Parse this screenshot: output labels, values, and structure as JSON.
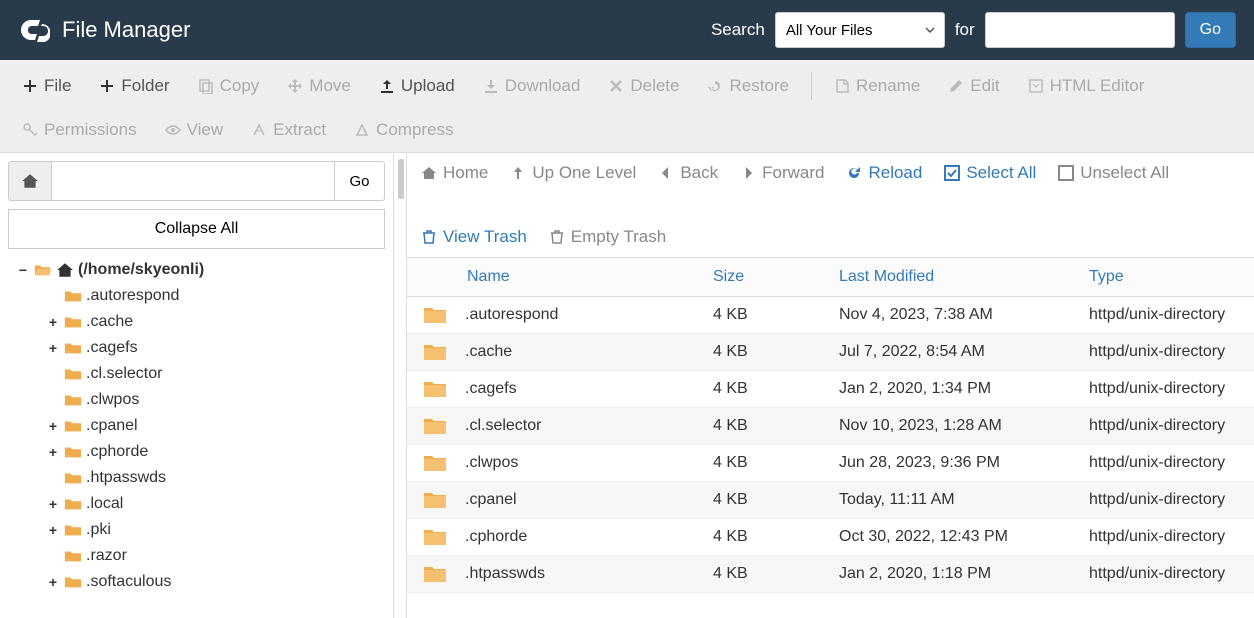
{
  "header": {
    "title": "File Manager",
    "search_label": "Search",
    "search_scope": "All Your Files",
    "for_label": "for",
    "search_value": "",
    "go": "Go"
  },
  "toolbar": {
    "file": "File",
    "folder": "Folder",
    "copy": "Copy",
    "move": "Move",
    "upload": "Upload",
    "download": "Download",
    "delete": "Delete",
    "restore": "Restore",
    "rename": "Rename",
    "edit": "Edit",
    "html_editor": "HTML Editor",
    "permissions": "Permissions",
    "view": "View",
    "extract": "Extract",
    "compress": "Compress"
  },
  "sidebar": {
    "path_value": "",
    "go": "Go",
    "collapse_all": "Collapse All",
    "root_label": "(/home/skyeonli)",
    "items": [
      {
        "label": ".autorespond",
        "expandable": false
      },
      {
        "label": ".cache",
        "expandable": true
      },
      {
        "label": ".cagefs",
        "expandable": true
      },
      {
        "label": ".cl.selector",
        "expandable": false
      },
      {
        "label": ".clwpos",
        "expandable": false
      },
      {
        "label": ".cpanel",
        "expandable": true
      },
      {
        "label": ".cphorde",
        "expandable": true
      },
      {
        "label": ".htpasswds",
        "expandable": false
      },
      {
        "label": ".local",
        "expandable": true
      },
      {
        "label": ".pki",
        "expandable": true
      },
      {
        "label": ".razor",
        "expandable": false
      },
      {
        "label": ".softaculous",
        "expandable": true
      }
    ]
  },
  "actions": {
    "home": "Home",
    "up_one": "Up One Level",
    "back": "Back",
    "forward": "Forward",
    "reload": "Reload",
    "select_all": "Select All",
    "unselect_all": "Unselect All",
    "view_trash": "View Trash",
    "empty_trash": "Empty Trash"
  },
  "table": {
    "headers": {
      "name": "Name",
      "size": "Size",
      "modified": "Last Modified",
      "type": "Type"
    },
    "rows": [
      {
        "name": ".autorespond",
        "size": "4 KB",
        "modified": "Nov 4, 2023, 7:38 AM",
        "type": "httpd/unix-directory"
      },
      {
        "name": ".cache",
        "size": "4 KB",
        "modified": "Jul 7, 2022, 8:54 AM",
        "type": "httpd/unix-directory"
      },
      {
        "name": ".cagefs",
        "size": "4 KB",
        "modified": "Jan 2, 2020, 1:34 PM",
        "type": "httpd/unix-directory"
      },
      {
        "name": ".cl.selector",
        "size": "4 KB",
        "modified": "Nov 10, 2023, 1:28 AM",
        "type": "httpd/unix-directory"
      },
      {
        "name": ".clwpos",
        "size": "4 KB",
        "modified": "Jun 28, 2023, 9:36 PM",
        "type": "httpd/unix-directory"
      },
      {
        "name": ".cpanel",
        "size": "4 KB",
        "modified": "Today, 11:11 AM",
        "type": "httpd/unix-directory"
      },
      {
        "name": ".cphorde",
        "size": "4 KB",
        "modified": "Oct 30, 2022, 12:43 PM",
        "type": "httpd/unix-directory"
      },
      {
        "name": ".htpasswds",
        "size": "4 KB",
        "modified": "Jan 2, 2020, 1:18 PM",
        "type": "httpd/unix-directory"
      }
    ]
  }
}
